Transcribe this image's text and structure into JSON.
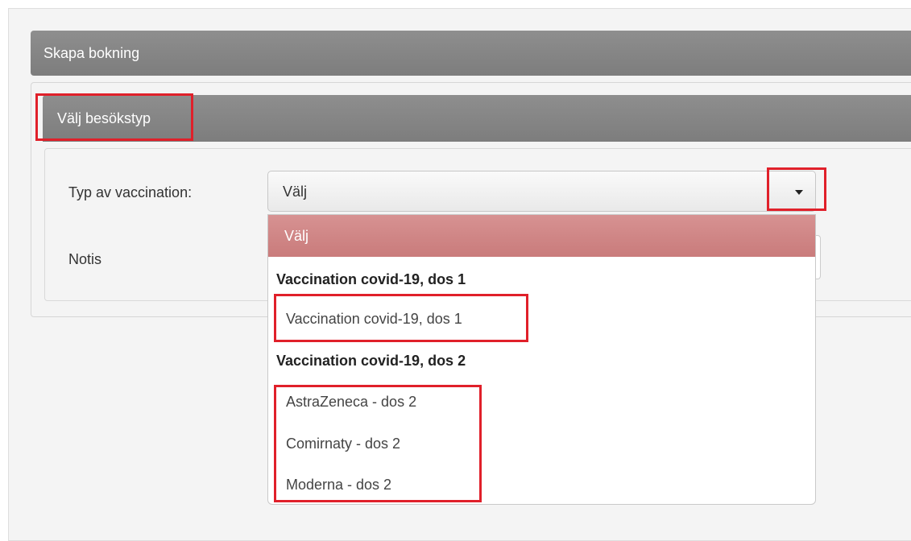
{
  "panel": {
    "title": "Skapa bokning"
  },
  "section": {
    "title": "Välj besökstyp"
  },
  "form": {
    "vaccination_label": "Typ av vaccination:",
    "vaccination_value": "Välj",
    "notis_label": "Notis"
  },
  "dropdown": {
    "selected": "Välj",
    "groups": [
      {
        "label": "Vaccination covid-19, dos 1",
        "options": [
          "Vaccination covid-19, dos 1"
        ]
      },
      {
        "label": "Vaccination covid-19, dos 2",
        "options": [
          "AstraZeneca - dos 2",
          "Comirnaty - dos 2",
          "Moderna - dos 2"
        ]
      }
    ]
  },
  "colors": {
    "header": "#858585",
    "highlight": "#e0202a",
    "selected_option": "#cf8585"
  }
}
